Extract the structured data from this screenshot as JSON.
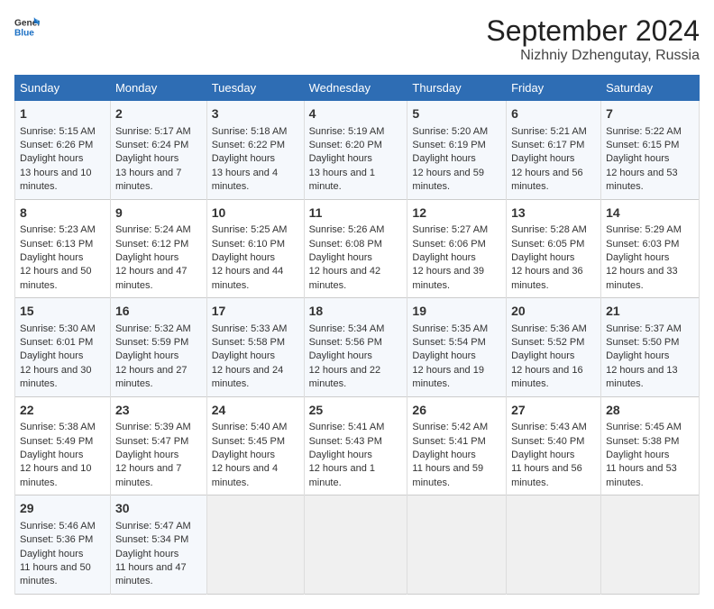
{
  "logo": {
    "text_general": "General",
    "text_blue": "Blue"
  },
  "title": "September 2024",
  "subtitle": "Nizhniy Dzhengutay, Russia",
  "headers": [
    "Sunday",
    "Monday",
    "Tuesday",
    "Wednesday",
    "Thursday",
    "Friday",
    "Saturday"
  ],
  "weeks": [
    [
      {
        "day": "1",
        "sunrise": "5:15 AM",
        "sunset": "6:26 PM",
        "daylight": "13 hours and 10 minutes."
      },
      {
        "day": "2",
        "sunrise": "5:17 AM",
        "sunset": "6:24 PM",
        "daylight": "13 hours and 7 minutes."
      },
      {
        "day": "3",
        "sunrise": "5:18 AM",
        "sunset": "6:22 PM",
        "daylight": "13 hours and 4 minutes."
      },
      {
        "day": "4",
        "sunrise": "5:19 AM",
        "sunset": "6:20 PM",
        "daylight": "13 hours and 1 minute."
      },
      {
        "day": "5",
        "sunrise": "5:20 AM",
        "sunset": "6:19 PM",
        "daylight": "12 hours and 59 minutes."
      },
      {
        "day": "6",
        "sunrise": "5:21 AM",
        "sunset": "6:17 PM",
        "daylight": "12 hours and 56 minutes."
      },
      {
        "day": "7",
        "sunrise": "5:22 AM",
        "sunset": "6:15 PM",
        "daylight": "12 hours and 53 minutes."
      }
    ],
    [
      {
        "day": "8",
        "sunrise": "5:23 AM",
        "sunset": "6:13 PM",
        "daylight": "12 hours and 50 minutes."
      },
      {
        "day": "9",
        "sunrise": "5:24 AM",
        "sunset": "6:12 PM",
        "daylight": "12 hours and 47 minutes."
      },
      {
        "day": "10",
        "sunrise": "5:25 AM",
        "sunset": "6:10 PM",
        "daylight": "12 hours and 44 minutes."
      },
      {
        "day": "11",
        "sunrise": "5:26 AM",
        "sunset": "6:08 PM",
        "daylight": "12 hours and 42 minutes."
      },
      {
        "day": "12",
        "sunrise": "5:27 AM",
        "sunset": "6:06 PM",
        "daylight": "12 hours and 39 minutes."
      },
      {
        "day": "13",
        "sunrise": "5:28 AM",
        "sunset": "6:05 PM",
        "daylight": "12 hours and 36 minutes."
      },
      {
        "day": "14",
        "sunrise": "5:29 AM",
        "sunset": "6:03 PM",
        "daylight": "12 hours and 33 minutes."
      }
    ],
    [
      {
        "day": "15",
        "sunrise": "5:30 AM",
        "sunset": "6:01 PM",
        "daylight": "12 hours and 30 minutes."
      },
      {
        "day": "16",
        "sunrise": "5:32 AM",
        "sunset": "5:59 PM",
        "daylight": "12 hours and 27 minutes."
      },
      {
        "day": "17",
        "sunrise": "5:33 AM",
        "sunset": "5:58 PM",
        "daylight": "12 hours and 24 minutes."
      },
      {
        "day": "18",
        "sunrise": "5:34 AM",
        "sunset": "5:56 PM",
        "daylight": "12 hours and 22 minutes."
      },
      {
        "day": "19",
        "sunrise": "5:35 AM",
        "sunset": "5:54 PM",
        "daylight": "12 hours and 19 minutes."
      },
      {
        "day": "20",
        "sunrise": "5:36 AM",
        "sunset": "5:52 PM",
        "daylight": "12 hours and 16 minutes."
      },
      {
        "day": "21",
        "sunrise": "5:37 AM",
        "sunset": "5:50 PM",
        "daylight": "12 hours and 13 minutes."
      }
    ],
    [
      {
        "day": "22",
        "sunrise": "5:38 AM",
        "sunset": "5:49 PM",
        "daylight": "12 hours and 10 minutes."
      },
      {
        "day": "23",
        "sunrise": "5:39 AM",
        "sunset": "5:47 PM",
        "daylight": "12 hours and 7 minutes."
      },
      {
        "day": "24",
        "sunrise": "5:40 AM",
        "sunset": "5:45 PM",
        "daylight": "12 hours and 4 minutes."
      },
      {
        "day": "25",
        "sunrise": "5:41 AM",
        "sunset": "5:43 PM",
        "daylight": "12 hours and 1 minute."
      },
      {
        "day": "26",
        "sunrise": "5:42 AM",
        "sunset": "5:41 PM",
        "daylight": "11 hours and 59 minutes."
      },
      {
        "day": "27",
        "sunrise": "5:43 AM",
        "sunset": "5:40 PM",
        "daylight": "11 hours and 56 minutes."
      },
      {
        "day": "28",
        "sunrise": "5:45 AM",
        "sunset": "5:38 PM",
        "daylight": "11 hours and 53 minutes."
      }
    ],
    [
      {
        "day": "29",
        "sunrise": "5:46 AM",
        "sunset": "5:36 PM",
        "daylight": "11 hours and 50 minutes."
      },
      {
        "day": "30",
        "sunrise": "5:47 AM",
        "sunset": "5:34 PM",
        "daylight": "11 hours and 47 minutes."
      },
      null,
      null,
      null,
      null,
      null
    ]
  ],
  "labels": {
    "sunrise": "Sunrise:",
    "sunset": "Sunset:",
    "daylight": "Daylight hours"
  }
}
